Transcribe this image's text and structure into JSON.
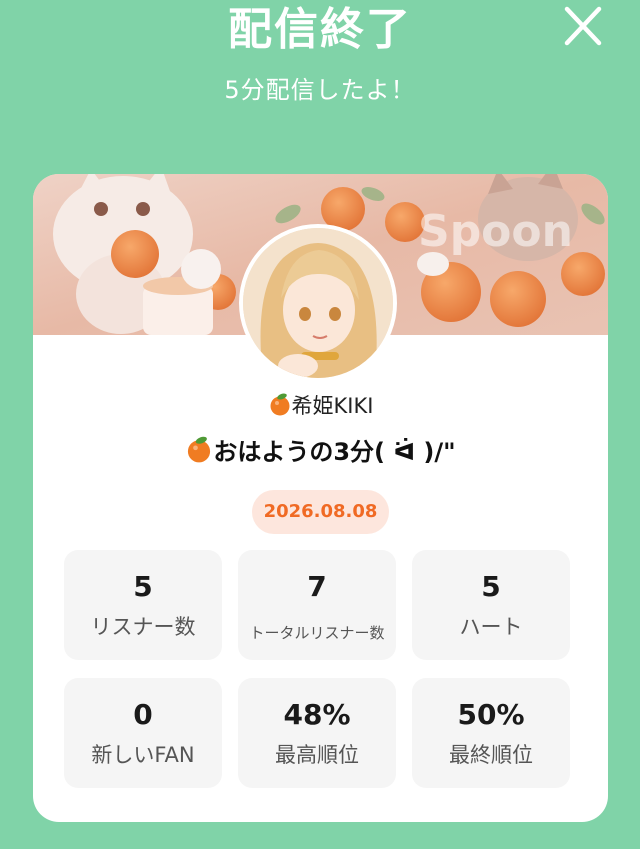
{
  "header": {
    "title": "配信終了",
    "subtitle": "5分配信したよ！"
  },
  "banner": {
    "watermark": "Spoon"
  },
  "profile": {
    "dj_name": "希姫KIKI",
    "live_title": "おはようの3分( ᐛ )/\"",
    "date": "2026.08.08"
  },
  "stats": [
    {
      "value": "5",
      "label": "リスナー数"
    },
    {
      "value": "7",
      "label": "トータルリスナー数"
    },
    {
      "value": "5",
      "label": "ハート"
    },
    {
      "value": "0",
      "label": "新しいFAN"
    },
    {
      "value": "48%",
      "label": "最高順位"
    },
    {
      "value": "50%",
      "label": "最終順位"
    }
  ],
  "icons": [
    "close-icon",
    "orange-emoji-icon"
  ],
  "colors": {
    "background": "#80d3a8",
    "accent": "#f06a24",
    "pill_bg": "#fde6dd",
    "stat_bg": "#f5f5f5"
  }
}
